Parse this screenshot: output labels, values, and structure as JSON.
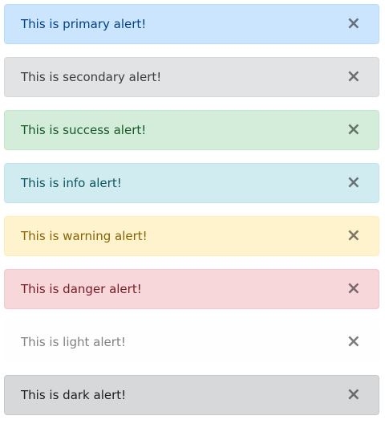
{
  "close_glyph": "×",
  "alerts": [
    {
      "text": "This is primary alert!",
      "bg": "#cce5ff",
      "border": "#b8daff",
      "color": "#004085"
    },
    {
      "text": "This is secondary alert!",
      "bg": "#e2e3e5",
      "border": "#d6d8db",
      "color": "#383d41"
    },
    {
      "text": "This is success alert!",
      "bg": "#d4edda",
      "border": "#c3e6cb",
      "color": "#155724"
    },
    {
      "text": "This is info alert!",
      "bg": "#d1ecf1",
      "border": "#bee5eb",
      "color": "#0c5460"
    },
    {
      "text": "This is warning alert!",
      "bg": "#fff3cd",
      "border": "#ffeeba",
      "color": "#856404"
    },
    {
      "text": "This is danger alert!",
      "bg": "#f8d7da",
      "border": "#f5c6cb",
      "color": "#721c24"
    },
    {
      "text": "This is light alert!",
      "bg": "#fefefe",
      "border": "#fdfdfe",
      "color": "#818182"
    },
    {
      "text": "This is dark alert!",
      "bg": "#d6d8d9",
      "border": "#c6c8ca",
      "color": "#1b1e21"
    }
  ]
}
